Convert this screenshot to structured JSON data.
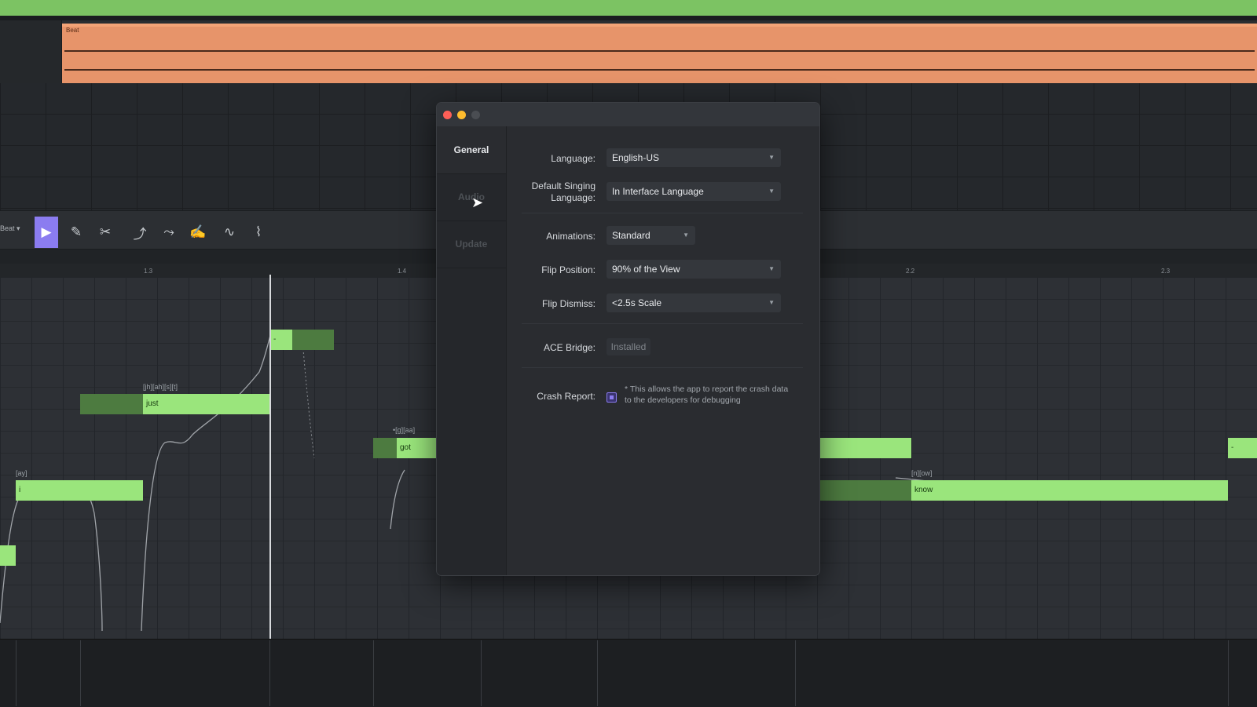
{
  "track": {
    "clip_label": "Beat"
  },
  "toolbar": {
    "beat_dropdown": "Beat ▾"
  },
  "ruler": {
    "labels": [
      "1.3",
      "1.4",
      "2.2",
      "2.3"
    ]
  },
  "notes": {
    "phonemes": [
      "[ay]",
      "[jh][ah][s][t]",
      "•[g][aa]",
      "[n][ow]"
    ],
    "lyrics": [
      "i",
      "just",
      "-",
      "got",
      "know",
      "-"
    ]
  },
  "dialog": {
    "sidebar": {
      "general": "General",
      "audio": "Audio",
      "update": "Update"
    },
    "language": {
      "label": "Language:",
      "value": "English-US"
    },
    "default_singing_language": {
      "label_line1": "Default Singing",
      "label_line2": "Language:",
      "value": "In Interface Language"
    },
    "animations": {
      "label": "Animations:",
      "value": "Standard"
    },
    "flip_position": {
      "label": "Flip Position:",
      "value": "90% of the View"
    },
    "flip_dismiss": {
      "label": "Flip Dismiss:",
      "value": "<2.5s Scale"
    },
    "ace_bridge": {
      "label": "ACE Bridge:",
      "status": "Installed"
    },
    "crash_report": {
      "label": "Crash Report:",
      "checked": true,
      "note": "* This allows the app to report the crash data to the developers for debugging"
    }
  },
  "colors": {
    "accent": "#8b7cf0",
    "note_green": "#9ae57c",
    "beat_clip": "#e7946a",
    "top_strip": "#7cc363"
  }
}
